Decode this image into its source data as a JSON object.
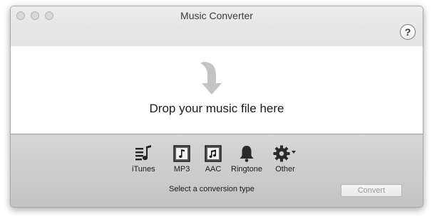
{
  "window": {
    "title": "Music Converter"
  },
  "help": {
    "label": "?"
  },
  "dropzone": {
    "text": "Drop your music file here"
  },
  "types": [
    {
      "label": "iTunes",
      "icon": "itunes-icon"
    },
    {
      "label": "MP3",
      "icon": "mp3-icon"
    },
    {
      "label": "AAC",
      "icon": "aac-icon"
    },
    {
      "label": "Ringtone",
      "icon": "bell-icon"
    },
    {
      "label": "Other",
      "icon": "gear-icon"
    }
  ],
  "hint": "Select a conversion type",
  "convert_button": {
    "label": "Convert"
  }
}
